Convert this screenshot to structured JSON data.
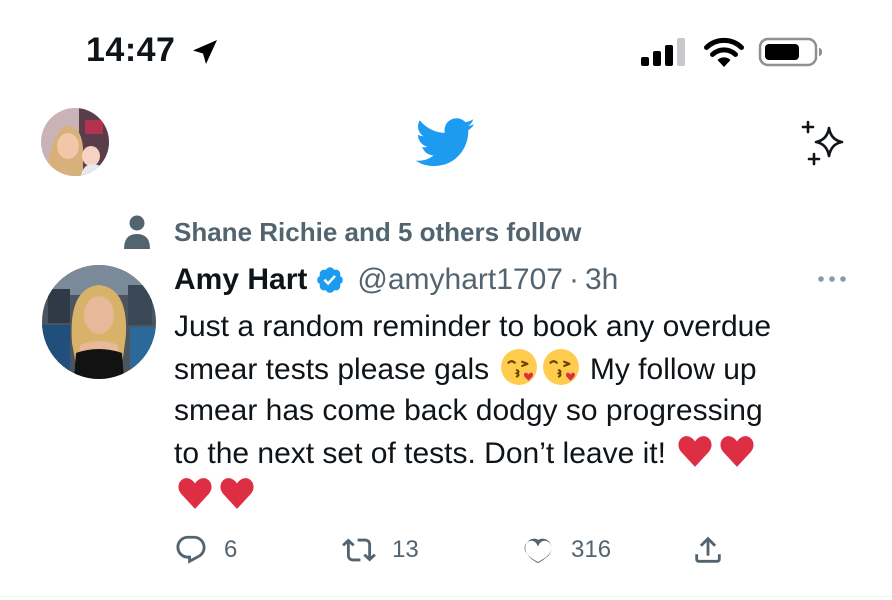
{
  "status_bar": {
    "time": "14:47",
    "location_icon": "location-arrow-icon",
    "signal_icon": "cellular-signal-icon",
    "wifi_icon": "wifi-icon",
    "battery_icon": "battery-icon"
  },
  "nav": {
    "profile_avatar": "profile-avatar",
    "logo_icon": "twitter-bird-icon",
    "sparkle_icon": "sparkle-icon",
    "brand_color": "#1d9bf0"
  },
  "tweet": {
    "social_context": "Shane Richie and 5 others follow",
    "author_name": "Amy Hart",
    "handle": "@amyhart1707",
    "separator": "·",
    "time": "3h",
    "lines": [
      {
        "text": "Just a random reminder to book any overdue"
      },
      {
        "text": "smear tests please gals",
        "emojis": [
          "kissing-face-heart-emoji",
          "kissing-face-heart-emoji"
        ],
        "after": "My follow up"
      },
      {
        "text": "smear has come back dodgy so progressing"
      },
      {
        "text": "to the next set of tests. Don’t leave it!",
        "emojis": [
          "red-heart-emoji",
          "red-heart-emoji"
        ]
      },
      {
        "emojis": [
          "red-heart-emoji",
          "red-heart-emoji"
        ]
      }
    ],
    "actions": {
      "reply_count": "6",
      "retweet_count": "13",
      "like_count": "316"
    }
  },
  "colors": {
    "text_primary": "#0f1419",
    "text_secondary": "#536471",
    "verified_blue": "#1d9bf0"
  }
}
